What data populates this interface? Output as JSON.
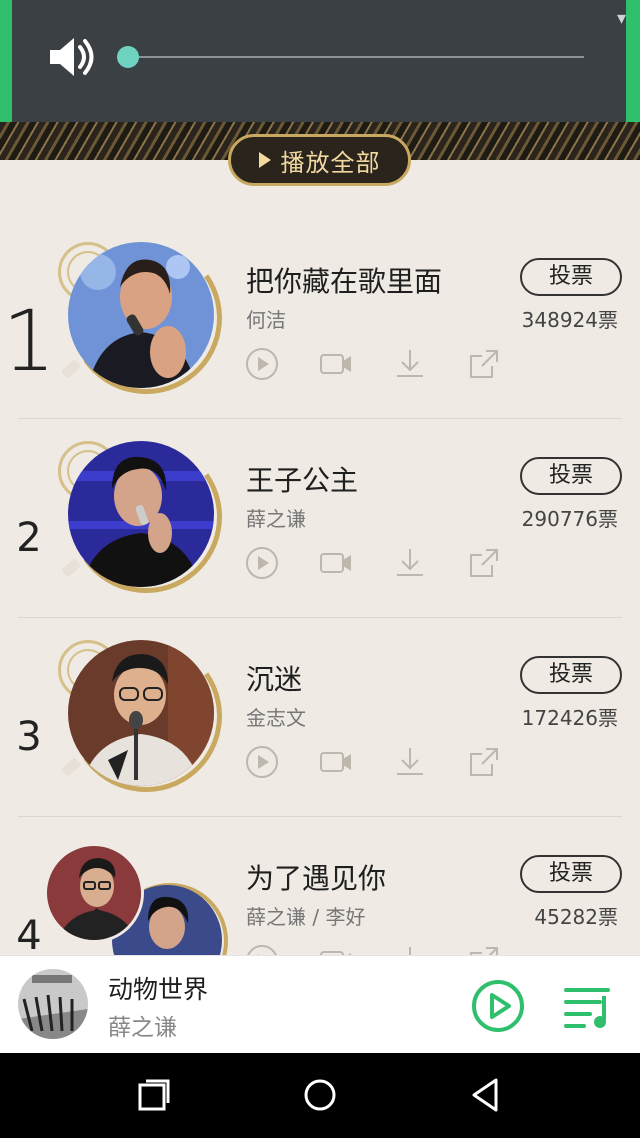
{
  "volume": {
    "level": 0.0,
    "icon": "volume-icon"
  },
  "banner": {
    "play_all_label": "播放全部"
  },
  "items": [
    {
      "rank": "1",
      "title": "把你藏在歌里面",
      "artist": "何洁",
      "vote_label": "投票",
      "votes": "348924票"
    },
    {
      "rank": "2",
      "title": "王子公主",
      "artist": "薛之谦",
      "vote_label": "投票",
      "votes": "290776票"
    },
    {
      "rank": "3",
      "title": "沉迷",
      "artist": "金志文",
      "vote_label": "投票",
      "votes": "172426票"
    },
    {
      "rank": "4",
      "title": "为了遇见你",
      "artist": "薛之谦 / 李好",
      "vote_label": "投票",
      "votes": "45282票"
    }
  ],
  "action_icons": [
    "play-circle-icon",
    "video-icon",
    "download-icon",
    "share-icon"
  ],
  "player": {
    "title": "动物世界",
    "artist": "薛之谦"
  },
  "colors": {
    "accent_green": "#2fbf6d",
    "gold": "#c9a860",
    "background": "#efebe4"
  }
}
